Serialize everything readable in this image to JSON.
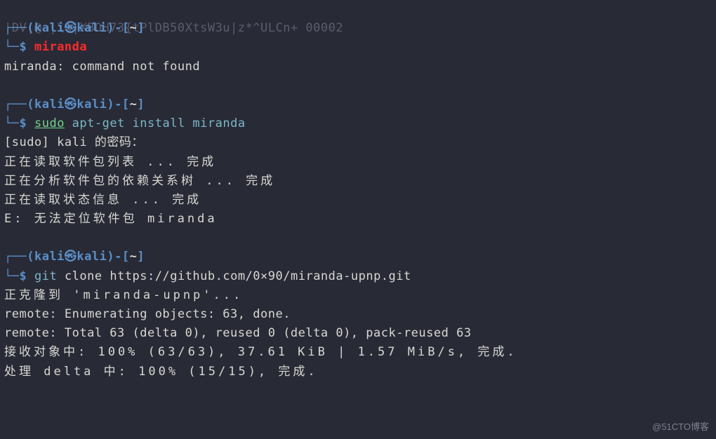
{
  "bg_garbage_1": "                                                                  ",
  "bg_garbage_2": "|DV|@ |\\$|XBOH73{tPlDB50XtsW3u|z*^ULCn+ 00002",
  "prompt": {
    "corner_top": "┌──",
    "paren_open": "(",
    "user": "kali",
    "skull": "㉿",
    "host": "kali",
    "paren_close": ")",
    "sep": "-",
    "bracket_open": "[",
    "path": "~",
    "bracket_close": "]",
    "corner_bottom": "└─",
    "dollar": "$"
  },
  "block1": {
    "cmd": "miranda",
    "out1": "miranda: command not found"
  },
  "block2": {
    "cmd_sudo": "sudo",
    "cmd_rest": " apt-get install miranda",
    "out1": "[sudo] kali 的密码：",
    "out2": "正在读取软件包列表 ... 完成",
    "out3": "正在分析软件包的依赖关系树 ... 完成",
    "out4": "正在读取状态信息 ... 完成",
    "out5": "E: 无法定位软件包 miranda"
  },
  "block3": {
    "cmd_git": "git",
    "cmd_rest": " clone https://github.com/0×90/miranda-upnp.git",
    "out1": "正克隆到 'miranda-upnp'...",
    "out2": "remote: Enumerating objects: 63, done.",
    "out3": "remote: Total 63 (delta 0), reused 0 (delta 0), pack-reused 63",
    "out4": "接收对象中: 100% (63/63), 37.61 KiB | 1.57 MiB/s, 完成.",
    "out5": "处理 delta 中: 100% (15/15), 完成."
  },
  "watermark": "@51CTO博客"
}
